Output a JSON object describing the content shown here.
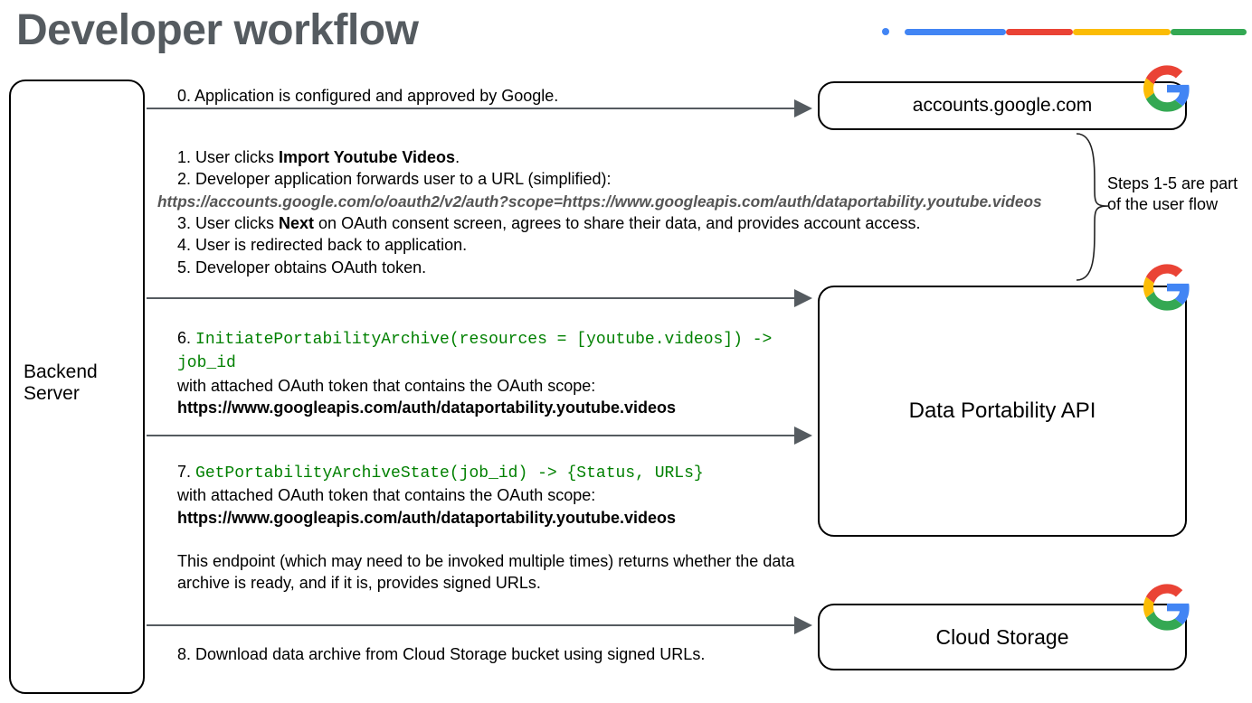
{
  "title": "Developer workflow",
  "boxes": {
    "backend": "Backend Server",
    "accounts": "accounts.google.com",
    "dpa": "Data Portability API",
    "cloud": "Cloud Storage"
  },
  "steps": {
    "s0": "0. Application is configured and approved by Google.",
    "s1_pre": "1. User clicks ",
    "s1_bold": "Import Youtube Videos",
    "s1_post": ".",
    "s2": "2. Developer application forwards user to a URL (simplified):",
    "s2_url": "https://accounts.google.com/o/oauth2/v2/auth?scope=https://www.googleapis.com/auth/dataportability.youtube.videos",
    "s3_pre": "3. User clicks ",
    "s3_bold": "Next",
    "s3_post": " on OAuth consent screen, agrees to share their data, and provides account access.",
    "s4": "4. User is redirected back to application.",
    "s5": "5. Developer obtains OAuth token.",
    "s6_num": "6. ",
    "s6_code": "InitiatePortabilityArchive(resources = [youtube.videos]) -> job_id",
    "s6_line2": "with attached OAuth token that contains the OAuth scope:",
    "s6_scope": "https://www.googleapis.com/auth/dataportability.youtube.videos",
    "s7_num": "7. ",
    "s7_code": "GetPortabilityArchiveState(job_id) -> {Status, URLs}",
    "s7_line2": "with attached OAuth token that contains the OAuth scope:",
    "s7_scope": "https://www.googleapis.com/auth/dataportability.youtube.videos",
    "s7_desc": "This endpoint (which may need to be invoked multiple times) returns whether the data archive is ready, and if it is, provides signed URLs.",
    "s8": "8. Download data archive from Cloud Storage bucket using signed URLs."
  },
  "aside": "Steps 1-5 are part of the user flow"
}
